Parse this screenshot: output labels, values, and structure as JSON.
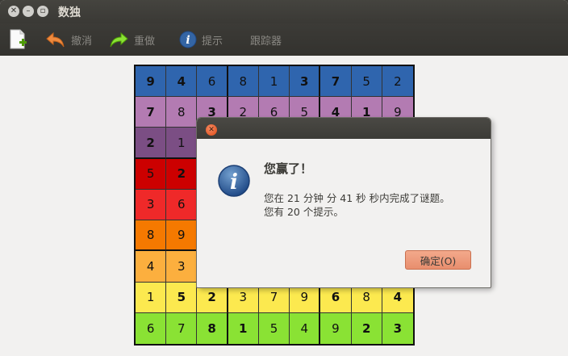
{
  "window": {
    "title": "数独"
  },
  "toolbar": {
    "new_icon": "new-document-icon",
    "undo_label": "撤消",
    "redo_label": "重做",
    "hint_label": "提示",
    "tracker_label": "跟踪器"
  },
  "board": {
    "row_colors": [
      "#2f65ae",
      "#b37bb2",
      "#7b4e84",
      "#cc0000",
      "#ef2929",
      "#f57900",
      "#fcaf3e",
      "#fce94f",
      "#8ae234"
    ],
    "rows": [
      [
        "9",
        "4",
        "6",
        "8",
        "1",
        "3",
        "7",
        "5",
        "2"
      ],
      [
        "7",
        "8",
        "3",
        "2",
        "6",
        "5",
        "4",
        "1",
        "9"
      ],
      [
        "2",
        "1",
        "",
        "",
        "",
        "",
        "",
        "",
        ""
      ],
      [
        "5",
        "2",
        "",
        "",
        "",
        "",
        "",
        "",
        ""
      ],
      [
        "3",
        "6",
        "",
        "",
        "",
        "",
        "",
        "",
        ""
      ],
      [
        "8",
        "9",
        "",
        "",
        "",
        "",
        "",
        "",
        ""
      ],
      [
        "4",
        "3",
        "",
        "",
        "",
        "",
        "",
        "",
        ""
      ],
      [
        "1",
        "5",
        "2",
        "3",
        "7",
        "9",
        "6",
        "8",
        "4"
      ],
      [
        "6",
        "7",
        "8",
        "1",
        "5",
        "4",
        "9",
        "2",
        "3"
      ]
    ],
    "bold": [
      [
        1,
        1,
        0,
        0,
        0,
        1,
        1,
        0,
        0
      ],
      [
        1,
        0,
        1,
        0,
        0,
        0,
        1,
        1,
        0
      ],
      [
        1,
        0,
        0,
        0,
        0,
        0,
        0,
        0,
        0
      ],
      [
        0,
        1,
        0,
        0,
        0,
        0,
        0,
        0,
        0
      ],
      [
        0,
        0,
        0,
        0,
        0,
        0,
        0,
        0,
        0
      ],
      [
        0,
        0,
        0,
        0,
        0,
        0,
        0,
        0,
        0
      ],
      [
        0,
        0,
        0,
        0,
        0,
        0,
        0,
        0,
        0
      ],
      [
        0,
        1,
        1,
        0,
        0,
        0,
        1,
        0,
        1
      ],
      [
        0,
        0,
        1,
        1,
        0,
        0,
        0,
        1,
        1
      ]
    ]
  },
  "dialog": {
    "heading": "您赢了！",
    "line1": "您在 21 分钟 分 41 秒 秒内完成了谜题。",
    "line2": "您有 20 个提示。",
    "ok_label": "确定(O)",
    "icon": "info-icon"
  }
}
